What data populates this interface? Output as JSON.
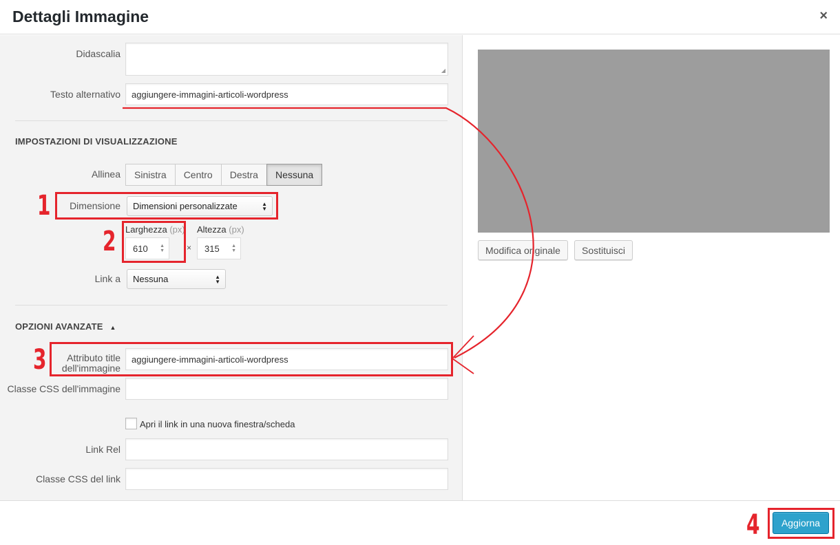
{
  "header": {
    "title": "Dettagli Immagine",
    "close_icon": "×"
  },
  "fields": {
    "caption_label": "Didascalia",
    "caption_value": "",
    "alt_label": "Testo alternativo",
    "alt_value": "aggiungere-immagini-articoli-wordpress"
  },
  "display_settings": {
    "title": "IMPOSTAZIONI DI VISUALIZZAZIONE",
    "align_label": "Allinea",
    "align_options": [
      "Sinistra",
      "Centro",
      "Destra",
      "Nessuna"
    ],
    "align_selected": "Nessuna",
    "size_label": "Dimensione",
    "size_value": "Dimensioni personalizzate",
    "width_label": "Larghezza",
    "width_unit": "(px)",
    "width_value": "610",
    "times": "×",
    "height_label": "Altezza",
    "height_unit": "(px)",
    "height_value": "315",
    "link_label": "Link a",
    "link_value": "Nessuna"
  },
  "advanced": {
    "title": "OPZIONI AVANZATE",
    "toggle_icon": "▲",
    "title_attr_label_line1": "Attributo title",
    "title_attr_label_line2": "dell'immagine",
    "title_attr_value": "aggiungere-immagini-articoli-wordpress",
    "image_css_label": "Classe CSS dell'immagine",
    "image_css_value": "",
    "new_window_label": "Apri il link in una nuova finestra/scheda",
    "link_rel_label": "Link Rel",
    "link_rel_value": "",
    "link_css_label": "Classe CSS del link",
    "link_css_value": ""
  },
  "preview": {
    "edit_original": "Modifica originale",
    "replace": "Sostituisci"
  },
  "footer": {
    "update_label": "Aggiorna"
  },
  "markers": [
    "1",
    "2",
    "3",
    "4"
  ],
  "colors": {
    "annotation_red": "#e5242c",
    "primary_blue": "#2ea2cc",
    "preview_gray": "#9d9d9d"
  }
}
